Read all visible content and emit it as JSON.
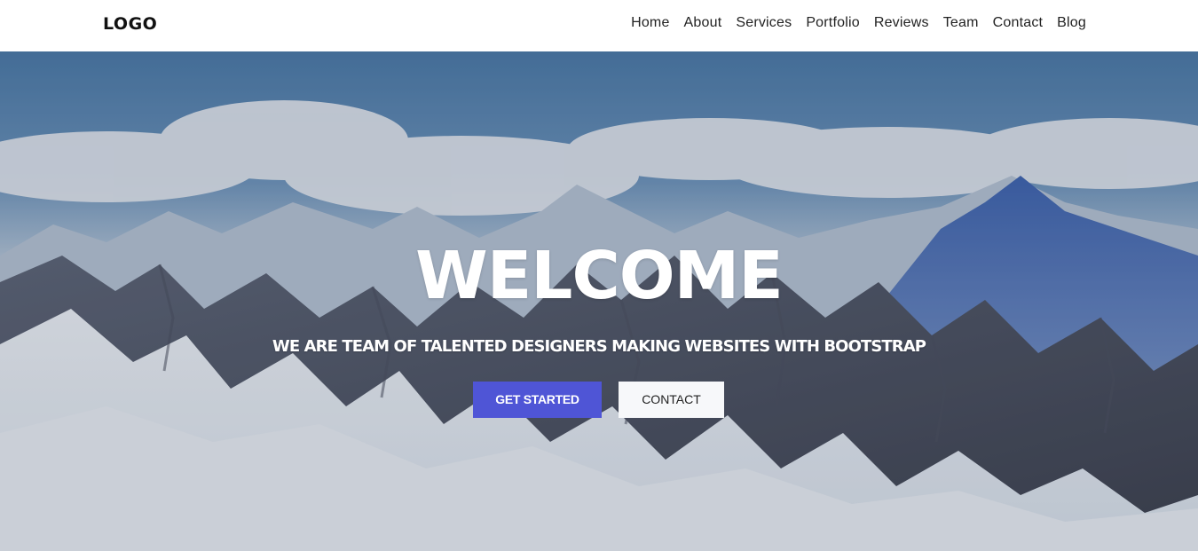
{
  "navbar": {
    "logo": "LOGO",
    "links": [
      "Home",
      "About",
      "Services",
      "Portfolio",
      "Reviews",
      "Team",
      "Contact",
      "Blog"
    ]
  },
  "hero": {
    "title": "WELCOME",
    "subtitle": "WE ARE TEAM OF TALENTED DESIGNERS MAKING WEBSITES WITH BOOTSTRAP",
    "primary_button": "GET STARTED",
    "secondary_button": "CONTACT",
    "background_image": "snowy-mountains-image"
  },
  "colors": {
    "accent": "#4f55d6",
    "sky": "#4a7aa8",
    "navbar_bg": "#ffffff",
    "secondary_button_bg": "#f7f8fa"
  }
}
